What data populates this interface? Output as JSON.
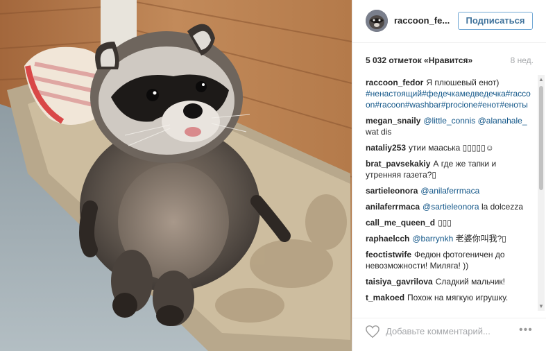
{
  "header": {
    "username": "raccoon_fe...",
    "follow_label": "Подписаться"
  },
  "meta": {
    "likes": "5 032 отметок «Нравится»",
    "age": "8 нед."
  },
  "comments": [
    {
      "author": "raccoon_fedor",
      "text": "Я плюшевый енот)",
      "link": "#ненастоящий#федечкамедведечка#raccoon#racoon#washbar#procione#енот#еноты"
    },
    {
      "author": "megan_snaily",
      "link": "@little_connis @alanahale_",
      "text": "wat dis"
    },
    {
      "author": "nataliy253",
      "text": "утии мааська ▯▯▯▯▯☺"
    },
    {
      "author": "brat_pavsekakiy",
      "text": "А где же тапки и утренняя газета?▯"
    },
    {
      "author": "sartieleonora",
      "link": "@anilaferrmaca",
      "text": ""
    },
    {
      "author": "anilaferrmaca",
      "link": "@sartieleonora",
      "text": "la dolcezza"
    },
    {
      "author": "call_me_queen_d",
      "text": "▯▯▯"
    },
    {
      "author": "raphaelcch",
      "link": "@barrynkh",
      "text": "老婆你叫我?▯"
    },
    {
      "author": "feoctistwife",
      "text": "Федюн фотогеничен до невозможности! Миляга! ))"
    },
    {
      "author": "taisiya_gavrilova",
      "text": "Сладкий мальчик!"
    },
    {
      "author": "t_makoed",
      "text": "Похож на мягкую игрушку."
    }
  ],
  "footer": {
    "placeholder": "Добавьте комментарий...",
    "more": "•••"
  }
}
